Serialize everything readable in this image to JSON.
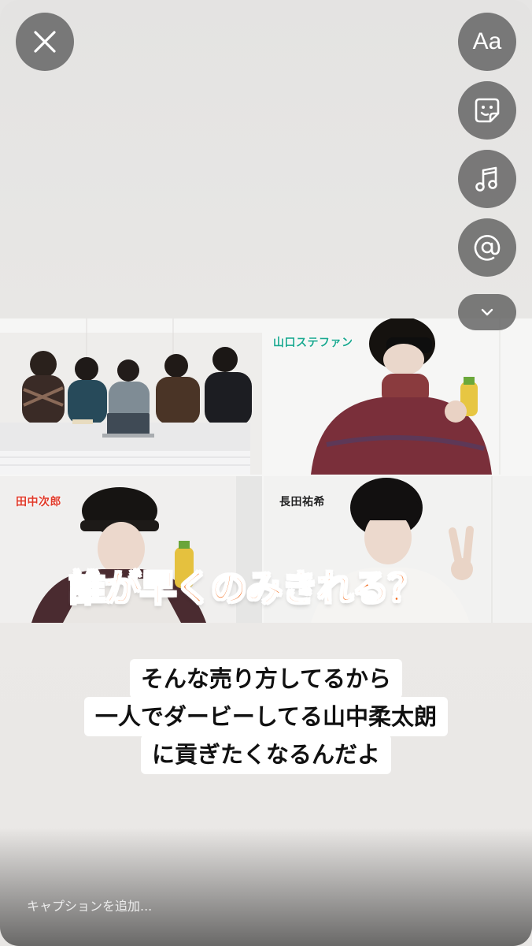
{
  "toolbar": {
    "text_tool_label": "Aa",
    "icons": [
      "close-icon",
      "text-icon",
      "sticker-icon",
      "music-icon",
      "mention-icon",
      "chevron-down-icon"
    ]
  },
  "collage": {
    "names": {
      "yamaguchi": "山口ステファン",
      "tanaka": "田中次郎",
      "nagata": "長田祐希"
    },
    "title": "誰が早くのみきれる？",
    "colors": {
      "title": "#f26a1b",
      "yamaguchi_tag": "#1aa88f",
      "tanaka_tag": "#e03a2a"
    }
  },
  "overlay_text": {
    "line1": "そんな売り方してるから",
    "line2": "一人でダービーしてる山中柔太朗",
    "line3": "に貢ぎたくなるんだよ"
  },
  "caption": {
    "placeholder": "キャプションを追加..."
  }
}
